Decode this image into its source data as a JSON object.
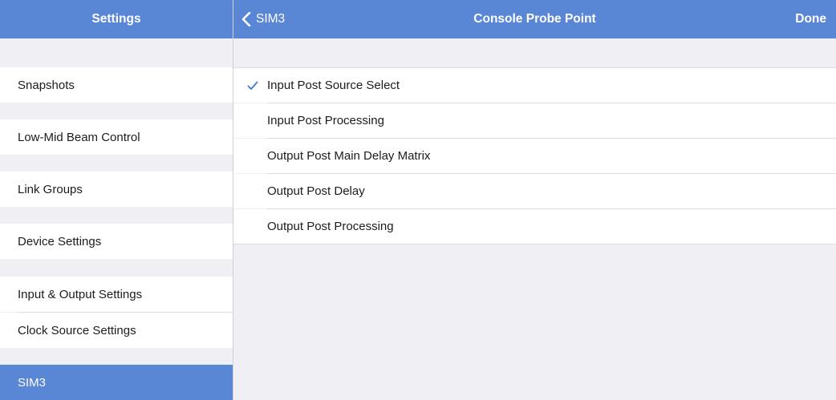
{
  "master": {
    "title": "Settings",
    "items": [
      {
        "label": "Snapshots"
      },
      {
        "label": "Low-Mid Beam Control"
      },
      {
        "label": "Link Groups"
      },
      {
        "label": "Device Settings"
      },
      {
        "label": "Input & Output Settings"
      },
      {
        "label": "Clock Source Settings"
      },
      {
        "label": "SIM3",
        "selected": true
      }
    ]
  },
  "detail": {
    "back_label": "SIM3",
    "title": "Console Probe Point",
    "done_label": "Done",
    "options": [
      {
        "label": "Input Post Source Select",
        "checked": true
      },
      {
        "label": "Input Post Processing",
        "checked": false
      },
      {
        "label": "Output Post Main Delay Matrix",
        "checked": false
      },
      {
        "label": "Output Post Delay",
        "checked": false
      },
      {
        "label": "Output Post Processing",
        "checked": false
      }
    ]
  },
  "colors": {
    "accent": "#5a86d6",
    "background": "#efeff4",
    "checkmark": "#3b78d8"
  }
}
